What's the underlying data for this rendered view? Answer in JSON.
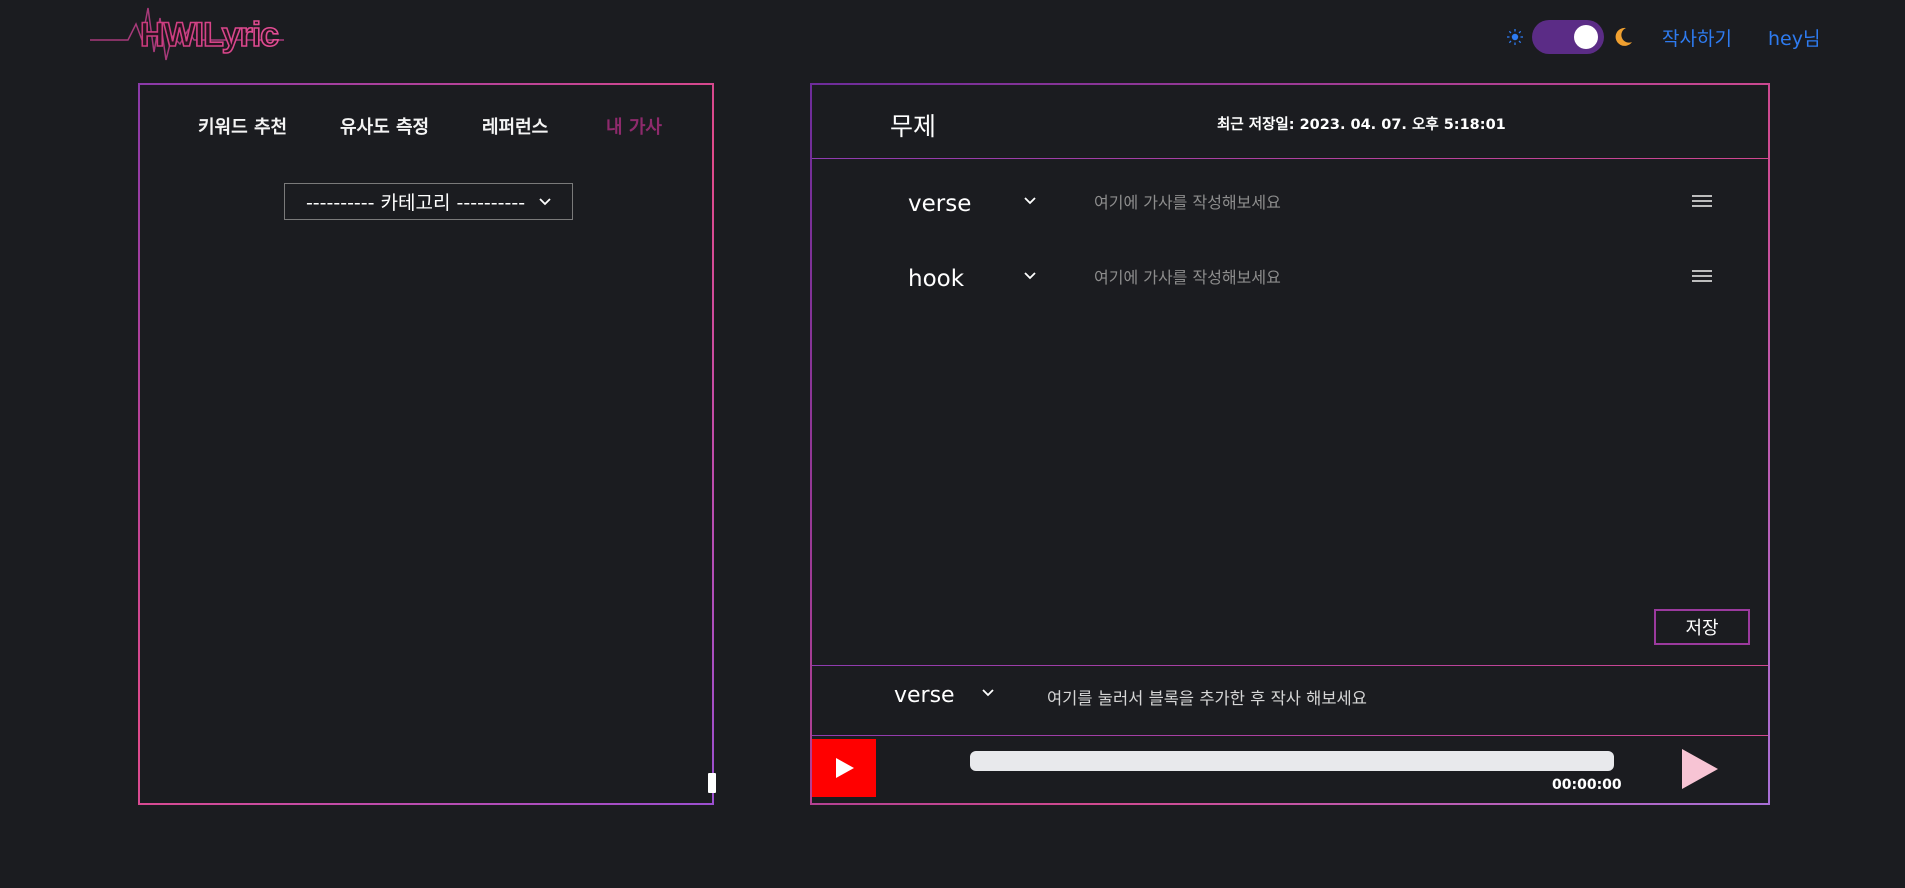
{
  "header": {
    "logo_text": "HWILyric",
    "write_link": "작사하기",
    "user_link": "hey님",
    "theme_toggle": {
      "mode": "dark"
    },
    "colors": {
      "link": "#2e7bf0",
      "toggle": "#5b2c86",
      "moon": "#f0a030",
      "sun": "#2e7bf0"
    }
  },
  "left_panel": {
    "tabs": [
      {
        "label": "키워드 추천",
        "active": false
      },
      {
        "label": "유사도 측정",
        "active": false
      },
      {
        "label": "레퍼런스",
        "active": false
      },
      {
        "label": "내 가사",
        "active": true
      }
    ],
    "category_select": "---------- 카테고리 ----------",
    "colors": {
      "active_tab": "#8e2a6c"
    }
  },
  "editor": {
    "title": "무제",
    "saved_at": "최근 저장일: 2023. 04. 07. 오후 5:18:01",
    "rows": [
      {
        "part": "verse",
        "placeholder": "여기에 가사를 작성해보세요",
        "value": ""
      },
      {
        "part": "hook",
        "placeholder": "여기에 가사를 작성해보세요",
        "value": ""
      }
    ],
    "save_label": "저장",
    "add_block": {
      "part": "verse",
      "hint": "여기를 눌러서 블록을 추가한 후 작사 해보세요"
    }
  },
  "player": {
    "time": "00:00:00",
    "progress": 0,
    "colors": {
      "youtube": "#ff0000",
      "play": "#f7c4d4"
    }
  }
}
